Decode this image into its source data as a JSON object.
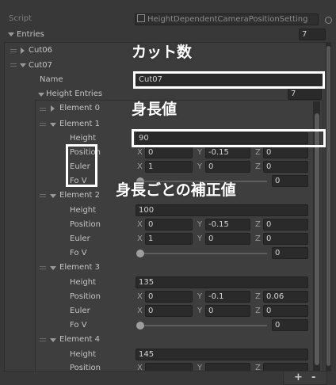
{
  "script_row": {
    "label": "Script",
    "value": "HeightDependentCameraPositionSetting"
  },
  "entries": {
    "label": "Entries",
    "count": "7"
  },
  "cut06": {
    "label": "Cut06"
  },
  "cut07": {
    "label": "Cut07",
    "name_label": "Name",
    "name_value": "Cut07",
    "height_entries_label": "Height Entries",
    "height_entries_count": "7"
  },
  "row_labels": {
    "height": "Height",
    "position": "Position",
    "euler": "Euler",
    "fov": "Fo V"
  },
  "axes": {
    "x": "X",
    "y": "Y",
    "z": "Z"
  },
  "elements": [
    {
      "label": "Element 0"
    },
    {
      "label": "Element 1",
      "height": "90",
      "position": [
        "0",
        "-0.15",
        "0"
      ],
      "euler": [
        "1",
        "0",
        "0"
      ],
      "fov": "0",
      "fov_fraction": 0
    },
    {
      "label": "Element 2",
      "height": "100",
      "position": [
        "0",
        "-0.15",
        "0"
      ],
      "euler": [
        "1",
        "0",
        "0"
      ],
      "fov": "0",
      "fov_fraction": 0
    },
    {
      "label": "Element 3",
      "height": "135",
      "position": [
        "0",
        "-0.1",
        "0.06"
      ],
      "euler": [
        "0",
        "0",
        "0"
      ],
      "fov": "0",
      "fov_fraction": 0
    },
    {
      "label": "Element 4",
      "height": "145",
      "position_label": "Position"
    }
  ],
  "annotations": {
    "cut_count": "カット数",
    "height": "身長値",
    "correction": "身長ごとの補正値"
  },
  "footer": {
    "add": "+",
    "remove": "-"
  }
}
